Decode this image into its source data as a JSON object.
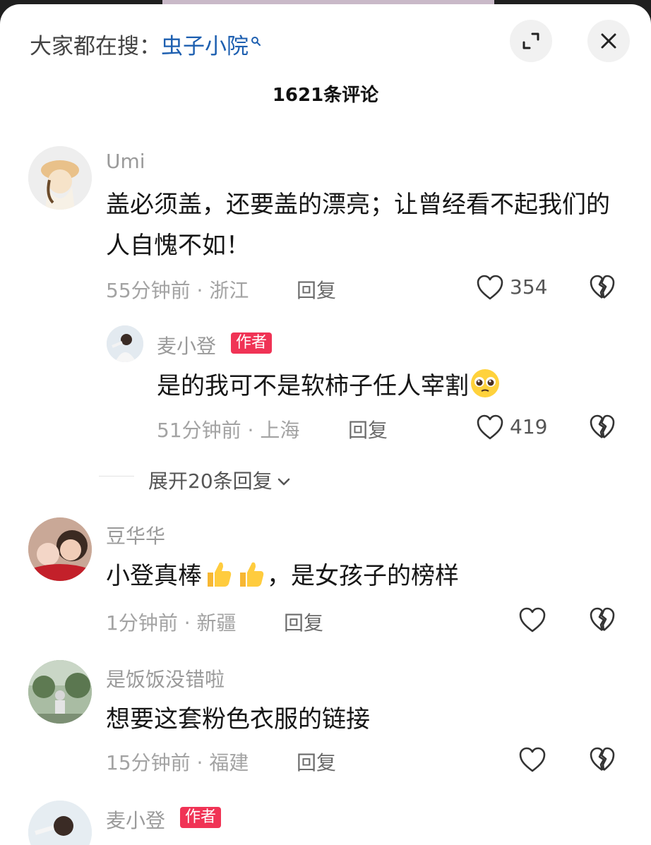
{
  "header": {
    "search_prefix": "大家都在搜：",
    "search_keyword": "虫子小院",
    "comment_count": "1621条评论"
  },
  "comments": [
    {
      "name": "Umi",
      "text": "盖必须盖，还要盖的漂亮；让曾经看不起我们的人自愧不如！",
      "time_location": "55分钟前 · 浙江",
      "reply_label": "回复",
      "likes": "354"
    },
    {
      "name": "豆华华",
      "text": "小登真棒",
      "text_after": "，是女孩子的榜样",
      "time_location": "1分钟前 · 新疆",
      "reply_label": "回复"
    },
    {
      "name": "是饭饭没错啦",
      "text": "想要这套粉色衣服的链接",
      "time_location": "15分钟前 · 福建",
      "reply_label": "回复"
    },
    {
      "name": "麦小登",
      "badge": "作者"
    }
  ],
  "reply": {
    "name": "麦小登",
    "badge": "作者",
    "text": "是的我可不是软柿子任人宰割",
    "time_location": "51分钟前 · 上海",
    "reply_label": "回复",
    "likes": "419"
  },
  "expand_label": "展开20条回复",
  "icons": {
    "expand": "expand-icon",
    "close": "close-icon",
    "like": "heart-outline-icon",
    "dislike": "broken-heart-icon",
    "thumbs_up": "thumbs-up-emoji",
    "pleading": "pleading-face-emoji"
  },
  "colors": {
    "author_badge": "#f03355",
    "search_keyword": "#1d5fb0"
  }
}
